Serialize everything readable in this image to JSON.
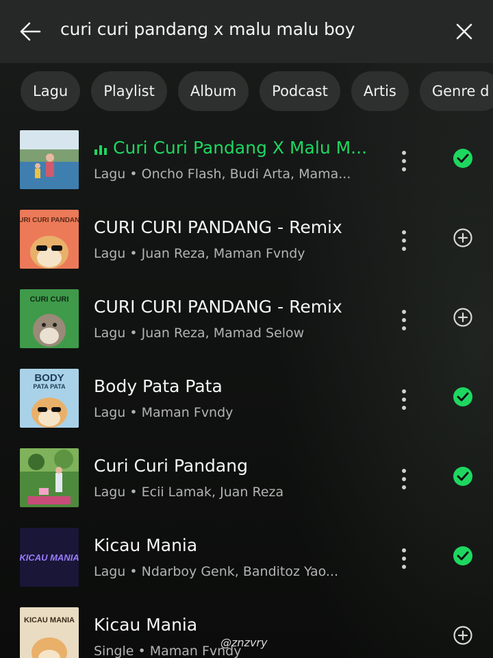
{
  "search": {
    "query": "curi curi pandang x malu malu boy"
  },
  "filters": [
    "Lagu",
    "Playlist",
    "Album",
    "Podcast",
    "Artis",
    "Genre d"
  ],
  "results": [
    {
      "title": "Curi Curi Pandang X Malu M...",
      "subtitle": "Lagu • Oncho Flash, Budi Arta, Mama...",
      "playing": true,
      "status": "saved"
    },
    {
      "title": "CURI CURI PANDANG - Remix",
      "subtitle": "Lagu • Juan Reza, Maman Fvndy",
      "playing": false,
      "status": "add"
    },
    {
      "title": "CURI CURI PANDANG - Remix",
      "subtitle": "Lagu • Juan Reza, Mamad Selow",
      "playing": false,
      "status": "add"
    },
    {
      "title": "Body Pata Pata",
      "subtitle": "Lagu • Maman Fvndy",
      "playing": false,
      "status": "saved"
    },
    {
      "title": "Curi Curi Pandang",
      "subtitle": "Lagu • Ecii Lamak, Juan Reza",
      "playing": false,
      "status": "saved"
    },
    {
      "title": "Kicau Mania",
      "subtitle": "Lagu • Ndarboy Genk, Banditoz Yao...",
      "playing": false,
      "status": "saved"
    },
    {
      "title": "Kicau Mania",
      "subtitle": "Single • Maman Fvndy",
      "playing": false,
      "status": "add"
    }
  ],
  "artwork_text": {
    "cover2": "CURI CURI PANDANG",
    "cover3": "CURI CURI",
    "cover4_top": "BODY",
    "cover4_bottom": "PATA PATA",
    "cover6": "KICAU MANIA",
    "cover7": "KICAU MANIA"
  },
  "watermark": "@znzvry",
  "colors": {
    "accent": "#1ed760",
    "topbar": "#262827",
    "chip": "#2e302f",
    "subtitle": "#b3b3b3"
  },
  "icons": {
    "back": "arrow-left-icon",
    "close": "close-icon",
    "more": "more-vertical-icon",
    "saved": "check-circle-icon",
    "add": "plus-circle-icon",
    "playing": "equalizer-icon"
  }
}
